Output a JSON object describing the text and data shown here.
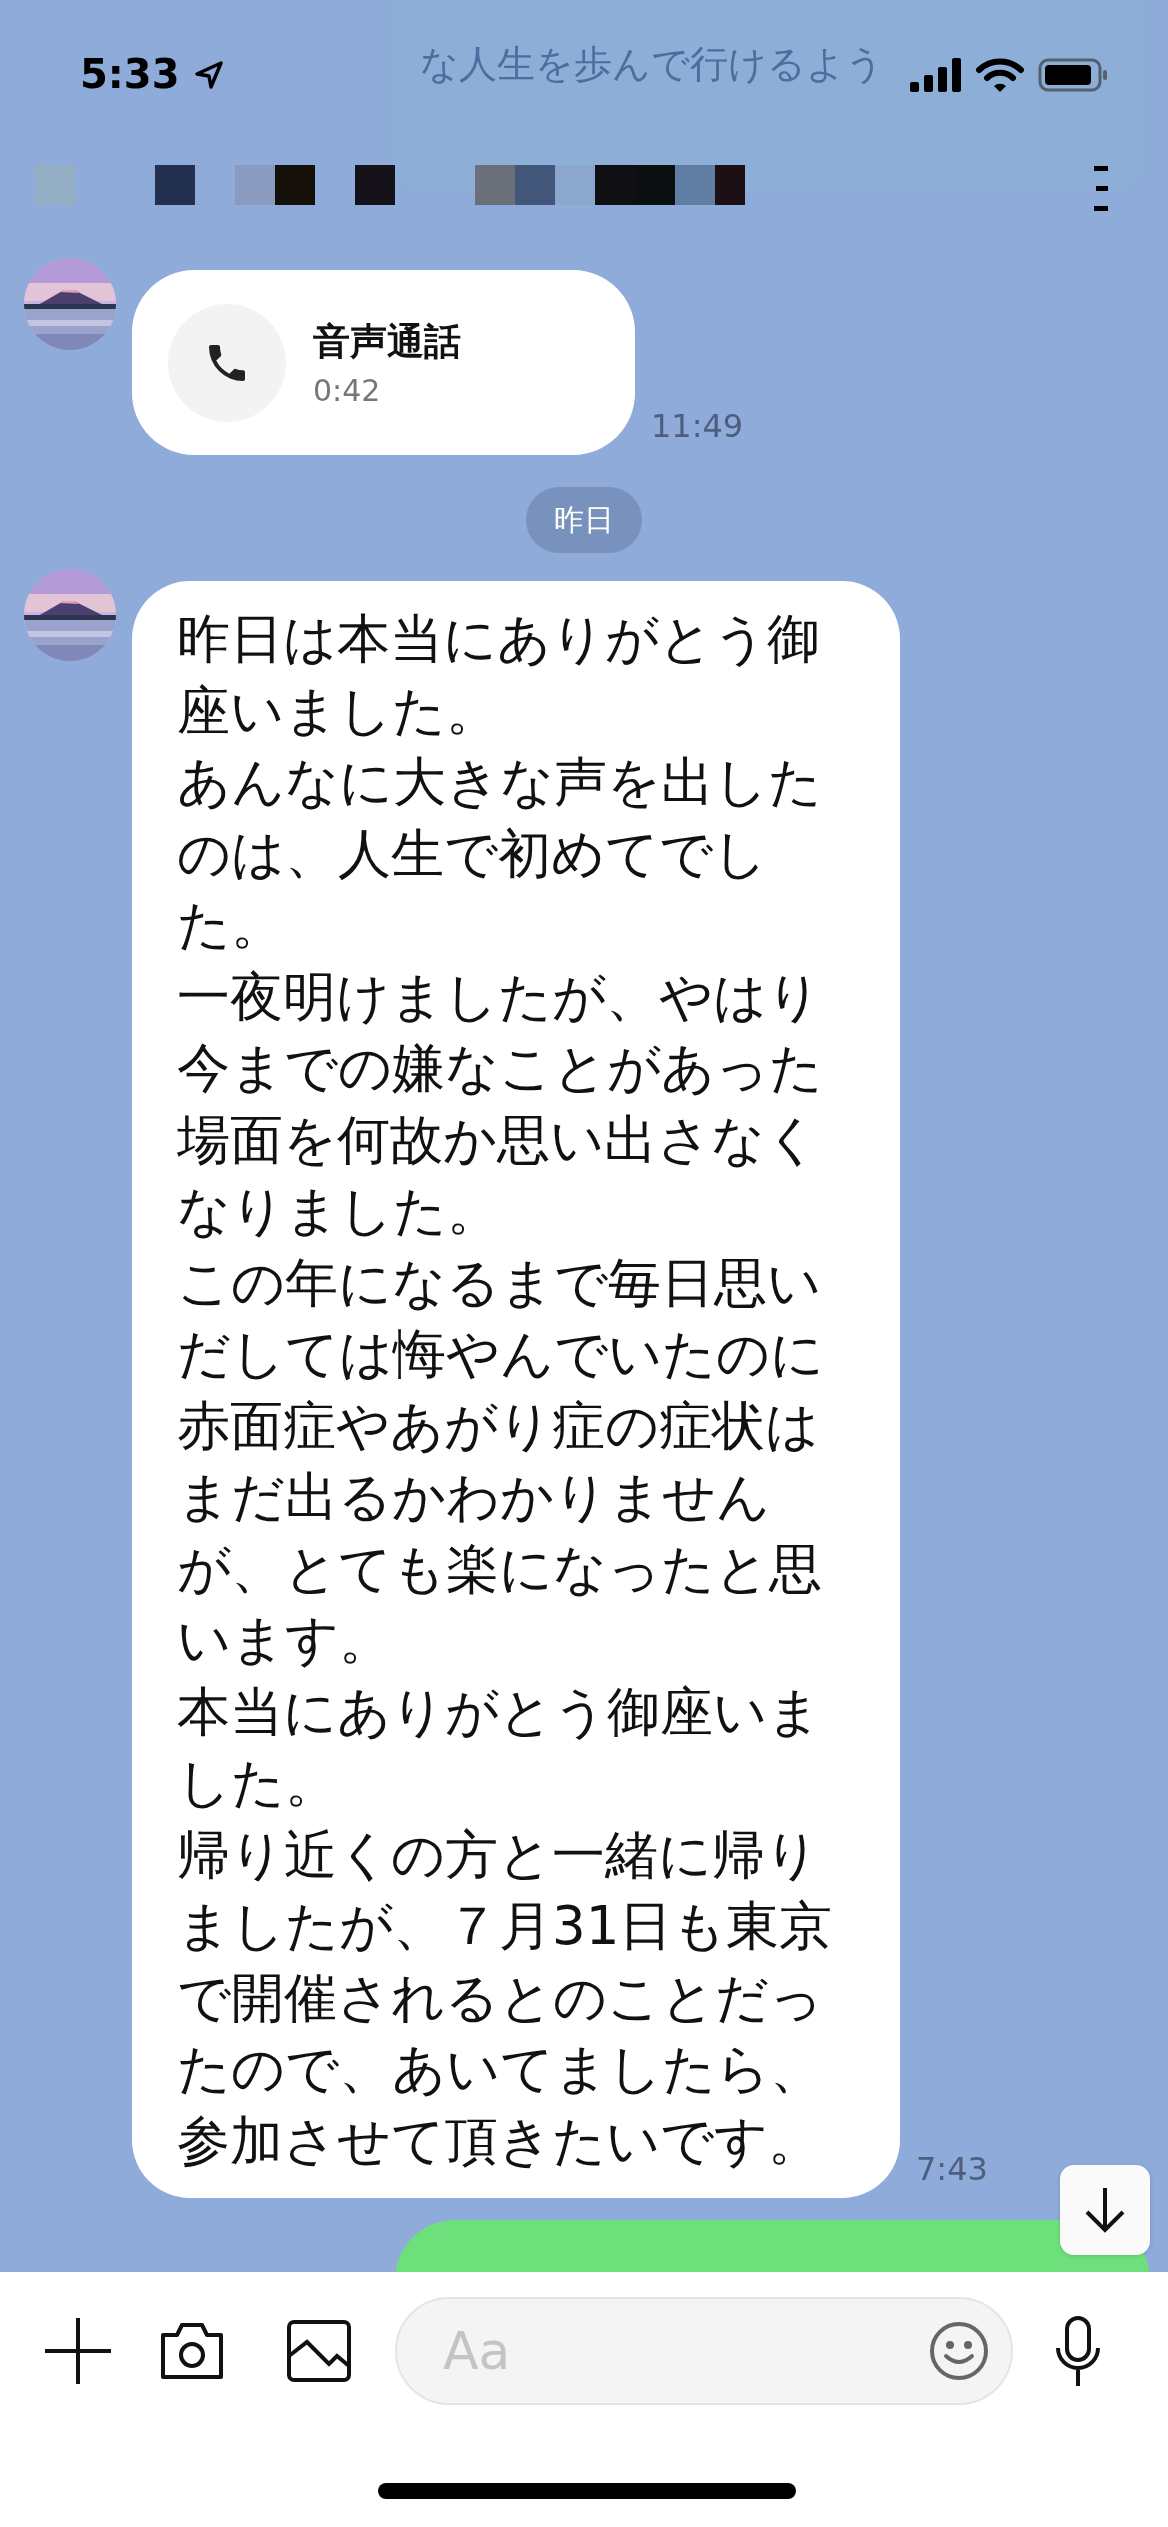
{
  "status_bar": {
    "time": "5:33"
  },
  "notification_banner": {
    "text": "な人生を歩んで行けるよう"
  },
  "messages": [
    {
      "kind": "call",
      "title": "音声通話",
      "duration": "0:42",
      "time": "11:49"
    },
    {
      "kind": "date",
      "label": "昨日"
    },
    {
      "kind": "text",
      "paragraphs": [
        "昨日は本当にありがとう御座いました。",
        "あんなに大きな声を出したのは、人生で初めてでした。",
        "一夜明けましたが、やはり今までの嫌なことがあった場面を何故か思い出さなくなりました。",
        "この年になるまで毎日思いだしては悔やんでいたのに",
        "赤面症やあがり症の症状はまだ出るかわかりませんが、とても楽になったと思います。",
        "本当にありがとう御座いました。",
        "帰り近くの方と一緒に帰りましたが、７月31日も東京で開催されるとのことだったので、あいてましたら、参加させて頂きたいです。"
      ],
      "time": "7:43"
    },
    {
      "kind": "outgoing"
    }
  ],
  "composer": {
    "placeholder": "Aa"
  }
}
